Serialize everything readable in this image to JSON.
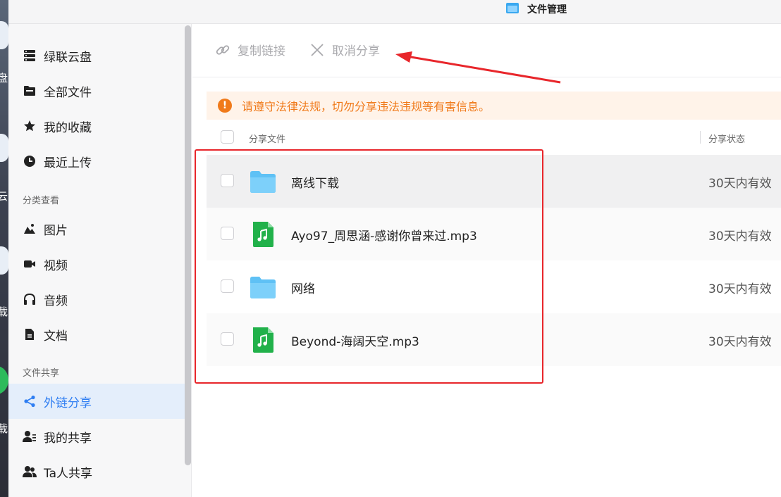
{
  "window": {
    "title": "文件管理"
  },
  "desktop": {
    "labels": [
      "盘",
      "云",
      "载",
      "载"
    ]
  },
  "sidebar": {
    "items": [
      {
        "label": "绿联云盘",
        "icon": "storage-icon"
      },
      {
        "label": "全部文件",
        "icon": "folder-icon"
      },
      {
        "label": "我的收藏",
        "icon": "star-icon"
      },
      {
        "label": "最近上传",
        "icon": "clock-icon"
      }
    ],
    "category_section": "分类查看",
    "category_items": [
      {
        "label": "图片",
        "icon": "image-icon"
      },
      {
        "label": "视频",
        "icon": "video-icon"
      },
      {
        "label": "音频",
        "icon": "headphones-icon"
      },
      {
        "label": "文档",
        "icon": "document-icon"
      }
    ],
    "share_section": "文件共享",
    "share_items": [
      {
        "label": "外链分享",
        "icon": "share-icon",
        "active": true
      },
      {
        "label": "我的共享",
        "icon": "user-share-icon"
      },
      {
        "label": "Ta人共享",
        "icon": "users-icon"
      }
    ]
  },
  "toolbar": {
    "copy_link": "复制链接",
    "cancel_share": "取消分享"
  },
  "notice": {
    "text": "请遵守法律法规，切勿分享违法违规等有害信息。"
  },
  "table": {
    "columns": {
      "name": "分享文件",
      "status": "分享状态"
    },
    "rows": [
      {
        "name": "离线下载",
        "type": "folder",
        "status": "30天内有效"
      },
      {
        "name": "Ayo97_周思涵-感谢你曾来过.mp3",
        "type": "audio",
        "status": "30天内有效"
      },
      {
        "name": "网络",
        "type": "folder",
        "status": "30天内有效"
      },
      {
        "name": "Beyond-海阔天空.mp3",
        "type": "audio",
        "status": "30天内有效"
      }
    ]
  },
  "colors": {
    "accent": "#2f7ef2",
    "warning": "#f07a1a",
    "annotation": "#e8262b",
    "folder": "#5fc1f5",
    "audio": "#21b14a"
  }
}
